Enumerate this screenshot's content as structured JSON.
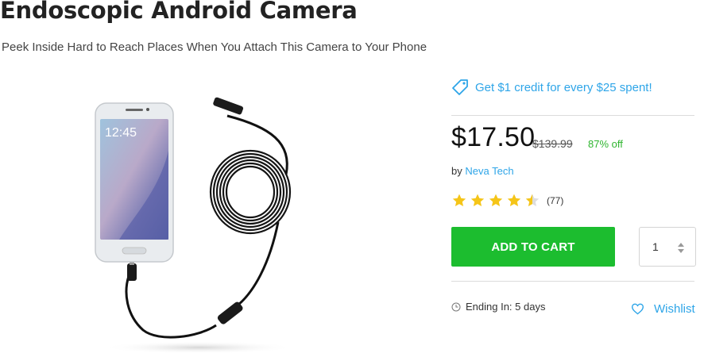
{
  "product": {
    "title": "Endoscopic Android Camera",
    "subtitle": "Peek Inside Hard to Reach Places When You Attach This Camera to Your Phone",
    "phone_time": "12:45"
  },
  "promo": {
    "text": "Get $1 credit for every $25 spent!",
    "icon": "price-tag-icon"
  },
  "pricing": {
    "price": "$17.50",
    "original_price": "$139.99",
    "discount": "87% off",
    "discount_color": "#2fb52f"
  },
  "seller": {
    "prefix": "by",
    "name": "Neva Tech"
  },
  "rating": {
    "value": 4.5,
    "max": 5,
    "count": "(77)",
    "star_color": "#f5c518"
  },
  "cart": {
    "button_label": "ADD TO CART",
    "quantity": "1",
    "button_color": "#1cbd2f"
  },
  "sale": {
    "ending_text": "Ending In: 5 days",
    "icon": "clock-icon"
  },
  "wishlist": {
    "label": "Wishlist",
    "icon": "heart-icon"
  },
  "colors": {
    "accent": "#2ea5e8"
  }
}
